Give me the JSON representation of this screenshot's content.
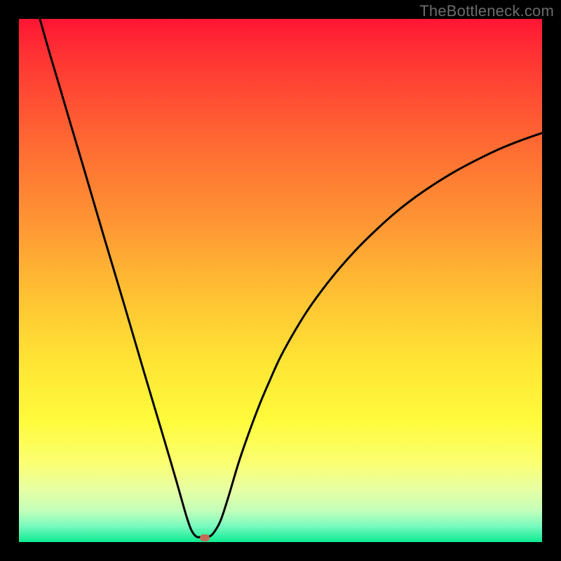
{
  "watermark": "TheBottleneck.com",
  "chart_data": {
    "type": "line",
    "title": "",
    "xlabel": "",
    "ylabel": "",
    "xlim": [
      0,
      100
    ],
    "ylim": [
      0,
      100
    ],
    "grid": false,
    "legend": false,
    "series": [
      {
        "name": "bottleneck-curve",
        "x": [
          4,
          6,
          8,
          10,
          12,
          14,
          16,
          18,
          20,
          22,
          24,
          26,
          28,
          30,
          32,
          33,
          34,
          35,
          36,
          37,
          38.5,
          40,
          42,
          44,
          46,
          48,
          50,
          53,
          56,
          60,
          64,
          68,
          72,
          76,
          80,
          84,
          88,
          92,
          96,
          100
        ],
        "y": [
          100,
          93,
          86.3,
          79.5,
          72.8,
          66,
          59.2,
          52.5,
          45.8,
          39,
          32.2,
          25.5,
          18.8,
          12,
          5,
          2.2,
          1.0,
          1.0,
          1.0,
          1.5,
          4,
          8.5,
          15.2,
          21,
          26.3,
          31,
          35.4,
          40.8,
          45.5,
          50.8,
          55.4,
          59.4,
          63,
          66.1,
          68.8,
          71.2,
          73.3,
          75.2,
          76.8,
          78.2
        ]
      }
    ],
    "marker": {
      "x": 35.5,
      "y": 0.8,
      "color": "#c36a58"
    },
    "gradient_stops": [
      {
        "pos": 0,
        "color": "#ff1533"
      },
      {
        "pos": 6,
        "color": "#ff2f34"
      },
      {
        "pos": 17,
        "color": "#ff5433"
      },
      {
        "pos": 29,
        "color": "#ff7933"
      },
      {
        "pos": 41,
        "color": "#ff9c34"
      },
      {
        "pos": 53,
        "color": "#ffc233"
      },
      {
        "pos": 65,
        "color": "#ffe334"
      },
      {
        "pos": 77,
        "color": "#fffb3c"
      },
      {
        "pos": 85,
        "color": "#fbff72"
      },
      {
        "pos": 90,
        "color": "#e7ffa4"
      },
      {
        "pos": 94,
        "color": "#c3ffba"
      },
      {
        "pos": 97,
        "color": "#77f9be"
      },
      {
        "pos": 100,
        "color": "#0ceb92"
      }
    ]
  }
}
